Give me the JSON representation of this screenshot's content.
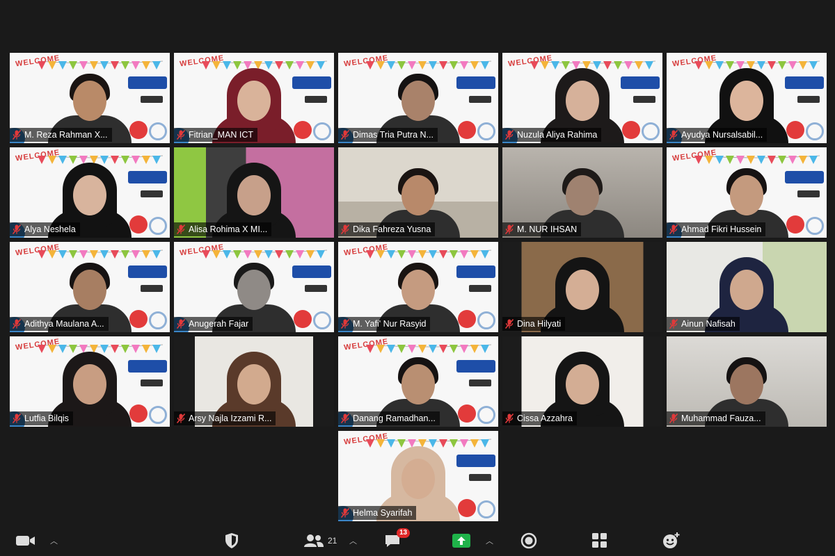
{
  "participants": [
    {
      "name": "M. Reza Rahman X...",
      "bg": "welcome",
      "skin": "#b98a68",
      "hair": "#1a1412",
      "hijab": false,
      "active": false
    },
    {
      "name": "Fitrian_MAN ICT",
      "bg": "welcome",
      "skin": "#d9b39a",
      "hair": "#7a1e2a",
      "hijab": true,
      "active": true
    },
    {
      "name": "Dimas Tria Putra N...",
      "bg": "welcome",
      "skin": "#a9826a",
      "hair": "#151212",
      "hijab": false,
      "active": false
    },
    {
      "name": "Nuzula Aliya Rahima",
      "bg": "welcome",
      "skin": "#d6b19a",
      "hair": "#1d1a1a",
      "hijab": true,
      "active": false
    },
    {
      "name": "Ayudya Nursalsabil...",
      "bg": "welcome",
      "skin": "#dcb59c",
      "hair": "#111",
      "hijab": true,
      "active": false
    },
    {
      "name": "Alya Neshela",
      "bg": "welcome",
      "skin": "#d8b49d",
      "hair": "#121212",
      "hijab": true,
      "active": false
    },
    {
      "name": "Alisa Rohima X MI...",
      "bg": "green",
      "skin": "#c7a08a",
      "hair": "#151515",
      "hijab": true,
      "active": false
    },
    {
      "name": "Dika Fahreza Yusna",
      "bg": "room",
      "skin": "#b8896a",
      "hair": "#1a1412",
      "hijab": false,
      "active": false
    },
    {
      "name": "M. NUR IHSAN",
      "bg": "closeup",
      "skin": "#9f8270",
      "hair": "#1e1a18",
      "hijab": false,
      "active": false
    },
    {
      "name": "Ahmad Fikri Hussein",
      "bg": "welcome",
      "skin": "#c49a7e",
      "hair": "#161212",
      "hijab": false,
      "active": false
    },
    {
      "name": "Adithya Maulana A...",
      "bg": "welcome",
      "skin": "#a77e62",
      "hair": "#161212",
      "hijab": false,
      "active": false
    },
    {
      "name": "Anugerah Fajar",
      "bg": "welcome",
      "skin": "#8f8a86",
      "hair": "#1a1a1a",
      "hijab": false,
      "active": false
    },
    {
      "name": "M. Yafi' Nur Rasyid",
      "bg": "welcome",
      "skin": "#c59b80",
      "hair": "#1a1412",
      "hijab": false,
      "active": false
    },
    {
      "name": "Dina Hilyati",
      "bg": "wood",
      "skin": "#d4ae95",
      "hair": "#141414",
      "hijab": true,
      "active": false
    },
    {
      "name": "Ainun Nafisah",
      "bg": "wall",
      "skin": "#cfa88e",
      "hair": "#1e2440",
      "hijab": true,
      "active": false
    },
    {
      "name": "Lutfia Bilqis",
      "bg": "welcome",
      "skin": "#c89d82",
      "hair": "#1c1818",
      "hijab": true,
      "active": false
    },
    {
      "name": "Arsy Najla Izzami R...",
      "bg": "plain",
      "skin": "#d2aa8e",
      "hair": "#5a3a2a",
      "hijab": true,
      "active": false
    },
    {
      "name": "Danang Ramadhan...",
      "bg": "welcome",
      "skin": "#b98f72",
      "hair": "#151212",
      "hijab": false,
      "active": false
    },
    {
      "name": "Cissa Azzahra",
      "bg": "dark",
      "skin": "#d3ad94",
      "hair": "#151515",
      "hijab": true,
      "active": false
    },
    {
      "name": "Muhammad Fauza...",
      "bg": "hall",
      "skin": "#9c7660",
      "hair": "#151212",
      "hijab": false,
      "active": false
    },
    {
      "name": "Helma Syarifah",
      "bg": "welcome",
      "skin": "#d4ad92",
      "hair": "#d6b8a0",
      "hijab": true,
      "active": false
    }
  ],
  "tile_banner": "WELCOME",
  "toolbar": {
    "video_icon": "video-camera-icon",
    "security_icon": "shield-icon",
    "participants_icon": "participants-icon",
    "participants_count": "21",
    "chat_icon": "chat-icon",
    "chat_badge": "13",
    "share_icon": "share-screen-icon",
    "record_icon": "record-icon",
    "apps_icon": "apps-grid-icon",
    "reactions_icon": "reactions-icon"
  },
  "colors": {
    "background": "#1a1a1a",
    "active_speaker": "#e0e04a",
    "share_green": "#1fb34a",
    "badge_red": "#e02828",
    "muted_red": "#e0393a"
  }
}
